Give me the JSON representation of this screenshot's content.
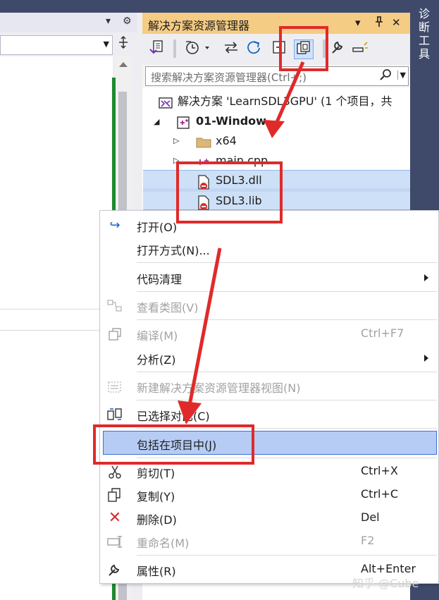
{
  "left_pane": {
    "dropdown_glyph": "▾",
    "settings_glyph": "⚙",
    "split_glyph": "⊕"
  },
  "solution_explorer": {
    "title": "解决方案资源管理器",
    "title_controls": [
      "▾",
      "ᵖ",
      "✕"
    ],
    "search_placeholder": "搜索解决方案资源管理器(Ctrl+;)",
    "tree": [
      {
        "label": "解决方案 'LearnSDL3GPU' (1 个项目，共",
        "icon": "solution-icon"
      },
      {
        "label": "01-Window",
        "icon": "project-icon"
      },
      {
        "label": "x64",
        "icon": "folder-icon"
      },
      {
        "label": "main.cpp",
        "icon": "cpp-file-icon"
      },
      {
        "label": "SDL3.dll",
        "icon": "excluded-file-icon"
      },
      {
        "label": "SDL3.lib",
        "icon": "excluded-file-icon"
      }
    ]
  },
  "side_tab": {
    "label": "诊断工具"
  },
  "context_menu": {
    "items": [
      {
        "label": "打开(O)",
        "shortcut": "",
        "icon": "open-arrow-icon"
      },
      {
        "label": "打开方式(N)...",
        "shortcut": "",
        "icon": ""
      },
      {
        "label": "代码清理",
        "shortcut": "",
        "icon": ""
      },
      {
        "label": "查看类图(V)",
        "shortcut": "",
        "icon": "class-diagram-icon"
      },
      {
        "label": "编译(M)",
        "shortcut": "Ctrl+F7",
        "icon": "compile-icon"
      },
      {
        "label": "分析(Z)",
        "shortcut": "",
        "icon": ""
      },
      {
        "label": "新建解决方案资源管理器视图(N)",
        "shortcut": "",
        "icon": "new-view-icon"
      },
      {
        "label": "已选择对比(C)",
        "shortcut": "",
        "icon": "compare-icon"
      },
      {
        "label": "包括在项目中(J)",
        "shortcut": "",
        "icon": ""
      },
      {
        "label": "剪切(T)",
        "shortcut": "Ctrl+X",
        "icon": "scissors-icon"
      },
      {
        "label": "复制(Y)",
        "shortcut": "Ctrl+C",
        "icon": "copy-icon"
      },
      {
        "label": "删除(D)",
        "shortcut": "Del",
        "icon": "delete-x-icon"
      },
      {
        "label": "重命名(M)",
        "shortcut": "F2",
        "icon": "rename-icon"
      },
      {
        "label": "属性(R)",
        "shortcut": "Alt+Enter",
        "icon": "wrench-icon"
      }
    ]
  },
  "watermark": "知乎 @Cube",
  "colors": {
    "title_bar": "#f5cc84",
    "selection": "#cde0f7",
    "highlight": "#b6ccf5",
    "annotation_red": "#e02a2a"
  }
}
